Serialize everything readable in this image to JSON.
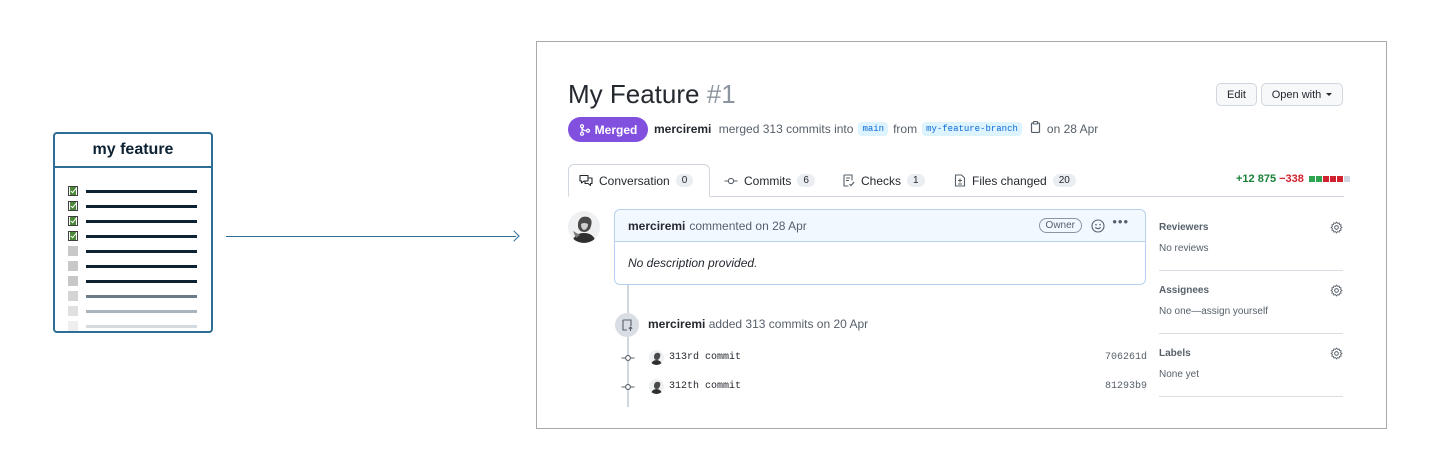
{
  "card": {
    "title": "my feature",
    "tasks": [
      {
        "checked": true,
        "line_color": "#0d2233",
        "box_color": "#4c8a3a"
      },
      {
        "checked": true,
        "line_color": "#0d2233",
        "box_color": "#4c8a3a"
      },
      {
        "checked": true,
        "line_color": "#0d2233",
        "box_color": "#4c8a3a"
      },
      {
        "checked": true,
        "line_color": "#0d2233",
        "box_color": "#4c8a3a"
      },
      {
        "checked": false,
        "line_color": "#0d2233",
        "box_color": "#c8c8c8"
      },
      {
        "checked": false,
        "line_color": "#0d2233",
        "box_color": "#c8c8c8"
      },
      {
        "checked": false,
        "line_color": "#0d2233",
        "box_color": "#c8c8c8"
      },
      {
        "checked": false,
        "line_color": "#6b7b88",
        "box_color": "#d4d4d4"
      },
      {
        "checked": false,
        "line_color": "#a9b4bd",
        "box_color": "#e0e0e0"
      },
      {
        "checked": false,
        "line_color": "#d5dce1",
        "box_color": "#eeeeee"
      }
    ]
  },
  "pr": {
    "title": "My Feature",
    "number": "#1",
    "edit_label": "Edit",
    "open_with_label": "Open with",
    "status_label": "Merged",
    "author": "merciremi",
    "merged_text": "merged 313 commits into",
    "base_branch": "main",
    "from_text": "from",
    "head_branch": "my-feature-branch",
    "date_text": "on 28 Apr"
  },
  "tabs": [
    {
      "label": "Conversation",
      "count": "0",
      "icon": "comment-discussion-icon"
    },
    {
      "label": "Commits",
      "count": "6",
      "icon": "git-commit-icon"
    },
    {
      "label": "Checks",
      "count": "1",
      "icon": "checklist-icon"
    },
    {
      "label": "Files changed",
      "count": "20",
      "icon": "file-diff-icon"
    }
  ],
  "diffstat": {
    "additions": "+12 875",
    "deletions": "−338",
    "blocks": [
      "#2da44e",
      "#2da44e",
      "#cf222e",
      "#cf222e",
      "#cf222e",
      "#d0d7de"
    ]
  },
  "comment": {
    "author": "merciremi",
    "action": "commented on 28 Apr",
    "badge": "Owner",
    "body": "No description provided."
  },
  "timeline": {
    "author": "merciremi",
    "event": "added 313 commits on 20 Apr",
    "commits": [
      {
        "message": "313rd commit",
        "sha": "706261d"
      },
      {
        "message": "312th commit",
        "sha": "81293b9"
      }
    ]
  },
  "sidebar": {
    "sections": [
      {
        "title": "Reviewers",
        "value": "No reviews"
      },
      {
        "title": "Assignees",
        "value": "No one—assign yourself"
      },
      {
        "title": "Labels",
        "value": "None yet"
      }
    ]
  },
  "colors": {
    "accent": "#2c6e96",
    "merged": "#8250df",
    "link": "#0969da"
  }
}
